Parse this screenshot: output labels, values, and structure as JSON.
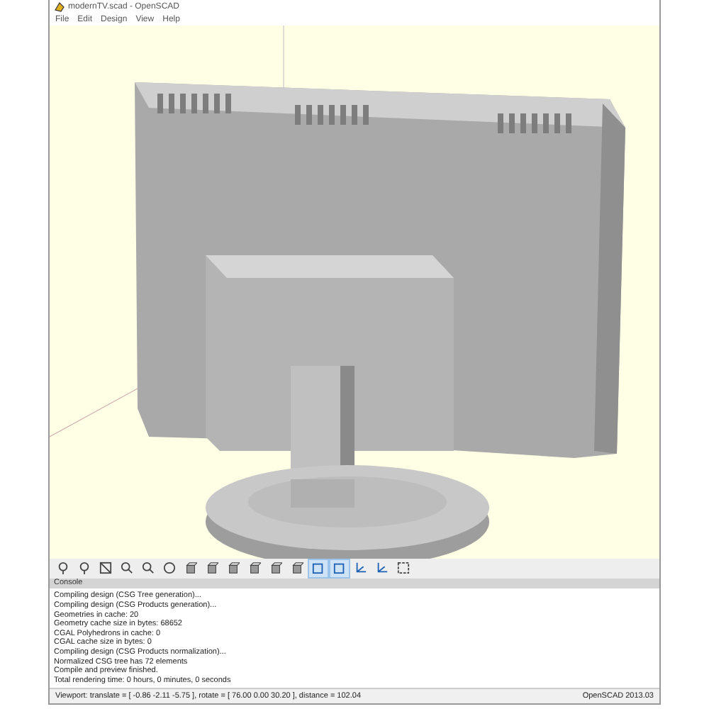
{
  "window": {
    "title": "modernTV.scad - OpenSCAD"
  },
  "menu": [
    "File",
    "Edit",
    "Design",
    "View",
    "Help"
  ],
  "toolbar_buttons": [
    {
      "kind": "preview",
      "selected": false
    },
    {
      "kind": "render",
      "selected": false
    },
    {
      "kind": "zoom-all",
      "selected": false
    },
    {
      "kind": "zoom-in",
      "selected": false
    },
    {
      "kind": "zoom-out",
      "selected": false
    },
    {
      "kind": "reset",
      "selected": false
    },
    {
      "kind": "cube",
      "selected": false
    },
    {
      "kind": "cube",
      "selected": false
    },
    {
      "kind": "cube",
      "selected": false
    },
    {
      "kind": "cube",
      "selected": false
    },
    {
      "kind": "cube",
      "selected": false
    },
    {
      "kind": "cube",
      "selected": false
    },
    {
      "kind": "perspective",
      "selected": true
    },
    {
      "kind": "orthogonal",
      "selected": true
    },
    {
      "kind": "axes",
      "selected": false
    },
    {
      "kind": "axes",
      "selected": false
    },
    {
      "kind": "edges",
      "selected": false
    }
  ],
  "console": {
    "title": "Console",
    "lines": [
      "Compiling design (CSG Tree generation)...",
      "Compiling design (CSG Products generation)...",
      "Geometries in cache: 20",
      "Geometry cache size in bytes: 68652",
      "CGAL Polyhedrons in cache: 0",
      "CGAL cache size in bytes: 0",
      "Compiling design (CSG Products normalization)...",
      "Normalized CSG tree has 72 elements",
      "Compile and preview finished.",
      "Total rendering time: 0 hours, 0 minutes, 0 seconds"
    ]
  },
  "status_bar": {
    "viewport": "Viewport: translate = [ -0.86 -2.11 -5.75 ], rotate = [ 76.00 0.00 30.20 ], distance = 102.04",
    "version": "OpenSCAD 2013.03"
  }
}
